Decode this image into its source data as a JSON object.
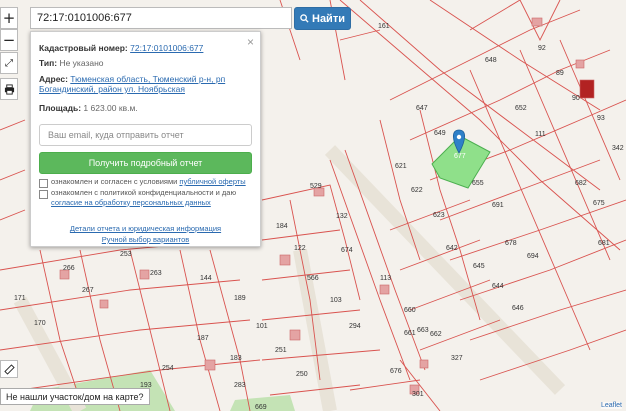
{
  "search": {
    "value": "72:17:0101006:677",
    "button_label": "Найти"
  },
  "controls": {
    "zoom_in": "+",
    "zoom_out": "−"
  },
  "popup": {
    "cadastral_label": "Кадастровый номер:",
    "cadastral_value": "72:17:0101006:677",
    "type_label": "Тип:",
    "type_value": "Не указано",
    "address_label": "Адрес:",
    "address_line1": "Тюменская область, Тюменский р-н, рп",
    "address_line2": "Богандинский, район ул. Ноябрьская",
    "area_label": "Площадь:",
    "area_value": "1 623.00 кв.м.",
    "email_placeholder": "Ваш email, куда отправить отчет",
    "report_button": "Получить подробный отчет",
    "consent1_text": "ознакомлен и согласен с условиями ",
    "consent1_link": "публичной оферты",
    "consent2_text": "ознакомлен с политикой конфиденциальности и даю",
    "consent2_link": "согласие на обработку персональных данных",
    "footer_link1": "Детали отчета и юридическая информация",
    "footer_link2": "Ручной выбор вариантов"
  },
  "bottom_button": "Не нашли участок/дом на карте?",
  "attribution": "Leaflet",
  "colors": {
    "parcel_line": "#d9534f",
    "selected_parcel": "#8fe08a",
    "marker": "#2f80c8",
    "report_button": "#5cb85c",
    "find_button": "#337ab7"
  },
  "map_labels": [
    "648",
    "92",
    "652",
    "111",
    "89",
    "90",
    "93",
    "342",
    "647",
    "649",
    "677",
    "680",
    "621",
    "622",
    "655",
    "682",
    "675",
    "681",
    "691",
    "623",
    "642",
    "678",
    "694",
    "674",
    "529",
    "526",
    "132",
    "184",
    "122",
    "674",
    "566",
    "114",
    "113",
    "263",
    "253",
    "171",
    "170",
    "266",
    "267",
    "144",
    "189",
    "101",
    "103",
    "294",
    "660",
    "661",
    "663",
    "662",
    "676",
    "286",
    "327",
    "187",
    "183",
    "254",
    "251",
    "250",
    "301",
    "193",
    "669",
    "642",
    "645",
    "644",
    "646",
    "681",
    "161"
  ]
}
